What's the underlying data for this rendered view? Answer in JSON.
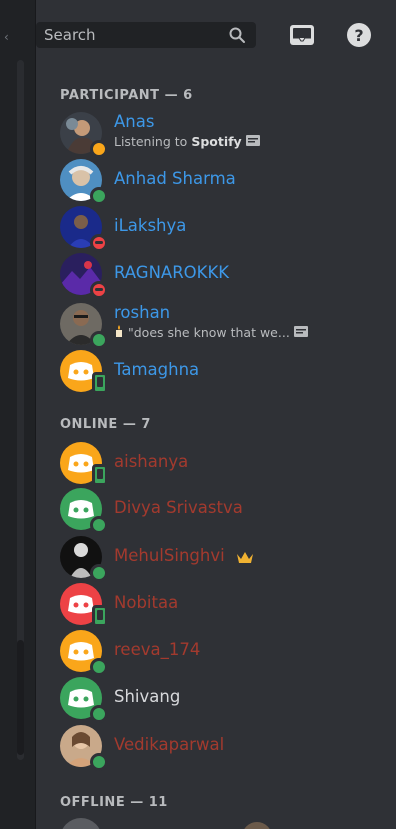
{
  "header": {
    "search_placeholder": "Search",
    "icons": [
      "search-icon",
      "inbox-icon",
      "help-icon"
    ]
  },
  "sections": {
    "participant": "PARTICIPANT — 6",
    "online": "ONLINE — 7",
    "offline": "OFFLINE — 11"
  },
  "participants": [
    {
      "name": "Anas",
      "activity_prefix": "Listening to",
      "activity_app": "Spotify",
      "status": "idle"
    },
    {
      "name": "Anhad Sharma",
      "status": "online"
    },
    {
      "name": "iLakshya",
      "status": "dnd"
    },
    {
      "name": "RAGNAROKKK",
      "status": "dnd"
    },
    {
      "name": "roshan",
      "activity": "\"does she know that we...",
      "status": "online"
    },
    {
      "name": "Tamaghna",
      "status": "mobile"
    }
  ],
  "online": [
    {
      "name": "aishanya",
      "status": "mobile"
    },
    {
      "name": "Divya Srivastva",
      "status": "online"
    },
    {
      "name": "MehulSinghvi",
      "status": "online",
      "crown": true
    },
    {
      "name": "Nobitaa",
      "status": "mobile"
    },
    {
      "name": "reeva_174",
      "status": "online"
    },
    {
      "name": "Shivang",
      "status": "online"
    },
    {
      "name": "Vedikaparwal",
      "status": "online"
    }
  ],
  "colors": {
    "participant_role": "#3d98e8",
    "online_role": "#a33a2e",
    "status_online": "#3ba55d",
    "status_dnd": "#ed4245",
    "status_idle": "#faa61a"
  }
}
